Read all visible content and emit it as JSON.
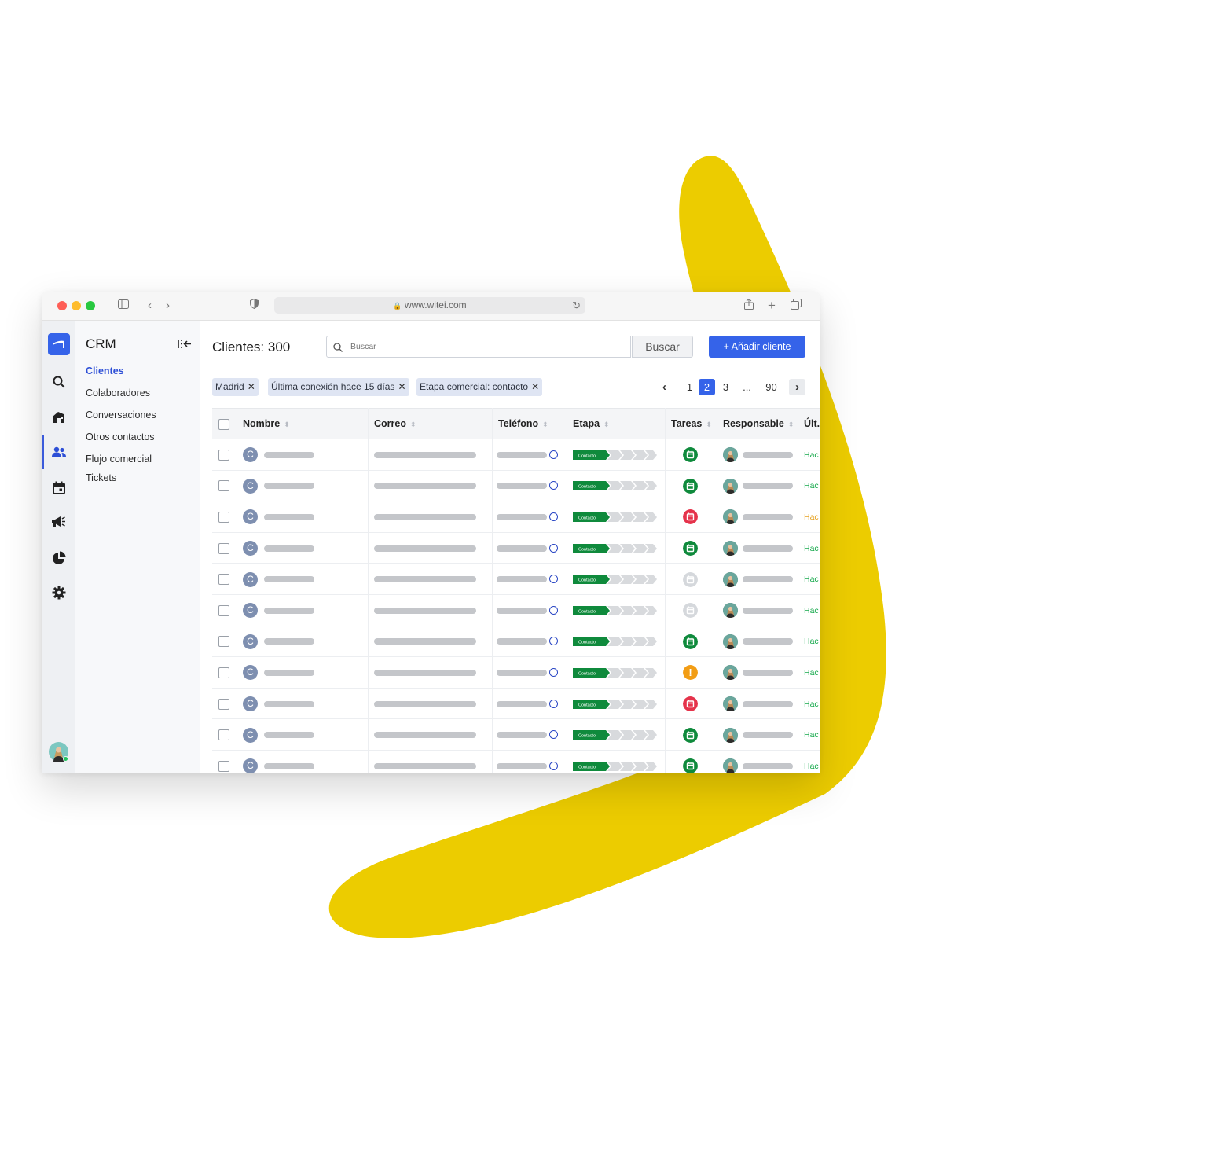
{
  "browser": {
    "url": "www.witei.com"
  },
  "colors": {
    "brand": "#3563e9",
    "boomerang": "#eccc00",
    "stage_green": "#0f8a3c",
    "task_green": "#0f8a3c",
    "task_red": "#e5334b",
    "task_gray": "#d5d8dc",
    "task_orange": "#f29d15",
    "last_green": "#14a84a",
    "last_orange": "#e6a11f"
  },
  "crm": {
    "title": "CRM",
    "items": [
      {
        "label": "Clientes",
        "active": true
      },
      {
        "label": "Colaboradores",
        "active": false
      },
      {
        "label": "Conversaciones",
        "active": false
      },
      {
        "label": "Otros contactos",
        "active": false
      },
      {
        "label": "Flujo comercial",
        "active": false
      },
      {
        "label": "Tickets",
        "active": false
      }
    ]
  },
  "rail_icons": [
    "brand-logo-icon",
    "search-icon",
    "home-icon",
    "users-icon",
    "calendar-icon",
    "megaphone-icon",
    "pie-chart-icon",
    "gear-icon",
    "user-avatar"
  ],
  "main": {
    "title": "Clientes: 300",
    "search_placeholder": "Buscar",
    "search_button": "Buscar",
    "add_button": "+  Añadir cliente",
    "filters": [
      "Madrid",
      "Última conexión hace 15 días",
      "Etapa comercial: contacto"
    ],
    "pagination": {
      "pages": [
        "1",
        "2",
        "3",
        "...",
        "90"
      ],
      "current": "2"
    }
  },
  "table": {
    "columns": [
      "Nombre",
      "Correo",
      "Teléfono",
      "Etapa",
      "Tareas",
      "Responsable",
      "Últ."
    ],
    "rows": [
      {
        "initial": "C",
        "stage": "Contacto",
        "task": "green",
        "last": "Hac",
        "last_color": "green"
      },
      {
        "initial": "C",
        "stage": "Contacto",
        "task": "green",
        "last": "Hac",
        "last_color": "green"
      },
      {
        "initial": "C",
        "stage": "Contacto",
        "task": "red",
        "last": "Hac",
        "last_color": "orange"
      },
      {
        "initial": "C",
        "stage": "Contacto",
        "task": "green",
        "last": "Hac",
        "last_color": "green"
      },
      {
        "initial": "C",
        "stage": "Contacto",
        "task": "gray",
        "last": "Hac",
        "last_color": "green"
      },
      {
        "initial": "C",
        "stage": "Contacto",
        "task": "gray",
        "last": "Hac",
        "last_color": "green"
      },
      {
        "initial": "C",
        "stage": "Contacto",
        "task": "green",
        "last": "Hac",
        "last_color": "green"
      },
      {
        "initial": "C",
        "stage": "Contacto",
        "task": "orange",
        "last": "Hac",
        "last_color": "green"
      },
      {
        "initial": "C",
        "stage": "Contacto",
        "task": "red",
        "last": "Hac",
        "last_color": "green"
      },
      {
        "initial": "C",
        "stage": "Contacto",
        "task": "green",
        "last": "Hac",
        "last_color": "green"
      },
      {
        "initial": "C",
        "stage": "Contacto",
        "task": "green",
        "last": "Hac",
        "last_color": "green"
      }
    ]
  }
}
